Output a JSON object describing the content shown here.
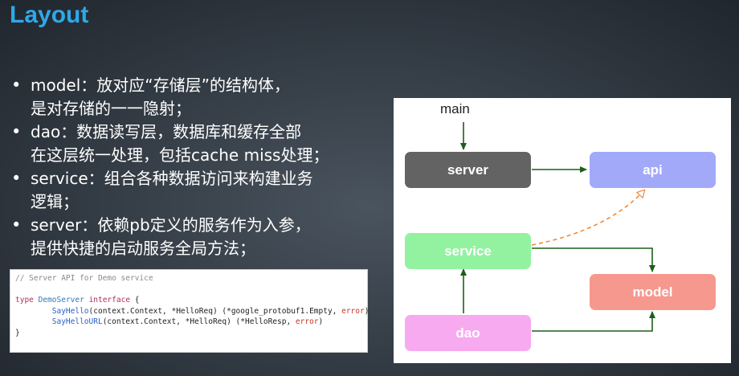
{
  "slide": {
    "title": "Layout",
    "bullets": [
      {
        "marker": "•",
        "text": "model：放对应“存储层”的结构体，\n是对存储的一一隐射；"
      },
      {
        "marker": "•",
        "text": "dao：数据读写层，数据库和缓存全部\n在这层统一处理，包括cache miss处理；"
      },
      {
        "marker": "•",
        "text": "service：组合各种数据访问来构建业务\n逻辑；"
      },
      {
        "marker": "•",
        "text": "server：依赖pb定义的服务作为入参，\n提供快捷的启动服务全局方法；"
      }
    ]
  },
  "code": {
    "comment": "// Server API for Demo service",
    "kw_type": "type",
    "type_name": "DemoServer",
    "kw_interface": "interface",
    "brace_open": "{",
    "m1_name": "SayHello",
    "m1_args": "(context.Context, *HelloReq) (*google_protobuf1.Empty, ",
    "m2_name": "SayHelloURL",
    "m2_args": "(context.Context, *HelloReq) (*HelloResp, ",
    "error_kw": "error",
    "close_paren": ")",
    "brace_close": "}"
  },
  "diagram": {
    "main_label": "main",
    "nodes": {
      "server": "server",
      "api": "api",
      "service": "service",
      "model": "model",
      "dao": "dao"
    },
    "colors": {
      "server": "#636363",
      "api": "#a2a9f8",
      "service": "#92f2a0",
      "model": "#f6988e",
      "dao": "#f7aaf0",
      "arrow": "#1c5e1c",
      "dashed_arrow": "#f08a3a"
    }
  }
}
